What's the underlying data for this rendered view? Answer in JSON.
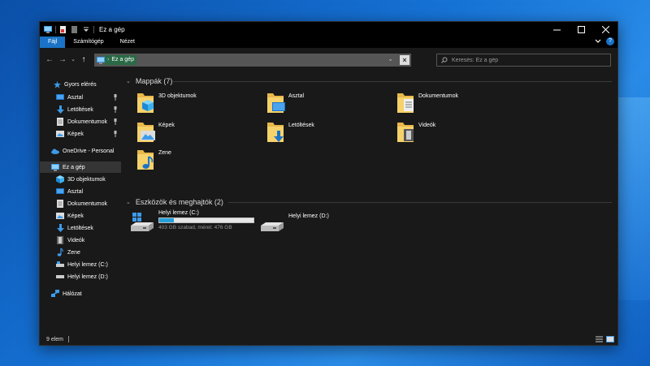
{
  "window": {
    "title": "Ez a gép"
  },
  "ribbon": {
    "tabs": [
      "Fájl",
      "Számítógép",
      "Nézet"
    ]
  },
  "address": {
    "location": "Ez a gép"
  },
  "search": {
    "placeholder": "Keresés: Ez a gép"
  },
  "sidebar": {
    "quick_access": "Gyors elérés",
    "quick_items": [
      "Asztal",
      "Letöltések",
      "Dokumentumok",
      "Képek"
    ],
    "onedrive": "OneDrive - Personal",
    "this_pc": "Ez a gép",
    "pc_items": [
      "3D objektumok",
      "Asztal",
      "Dokumentumok",
      "Képek",
      "Letöltések",
      "Videók",
      "Zene",
      "Helyi lemez (C:)",
      "Helyi lemez (D:)"
    ],
    "network": "Hálózat"
  },
  "main": {
    "folders_header": "Mappák (7)",
    "folders": [
      "3D objektumok",
      "Asztal",
      "Dokumentumok",
      "Képek",
      "Letöltések",
      "Videók",
      "Zene"
    ],
    "drives_header": "Eszközök és meghajtók (2)",
    "drives": [
      {
        "name": "Helyi lemez (C:)",
        "info": "403 GB szabad, méret: 476 GB",
        "used_fraction": 0.153
      },
      {
        "name": "Helyi lemez (D:)"
      }
    ]
  },
  "status": {
    "count": "9 elem"
  },
  "colors": {
    "accent": "#1a73c7",
    "bar_fill": "#26a0da",
    "background": "#191919",
    "selection": "#353535"
  }
}
